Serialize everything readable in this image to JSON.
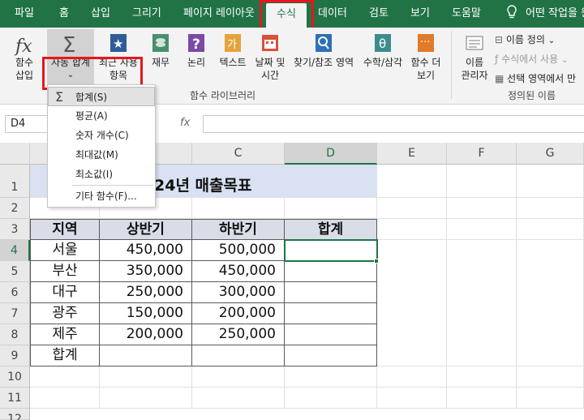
{
  "menu": {
    "tabs": [
      {
        "label": "파일"
      },
      {
        "label": "홈"
      },
      {
        "label": "삽입"
      },
      {
        "label": "그리기"
      },
      {
        "label": "페이지 레이아웃"
      },
      {
        "label": "수식"
      },
      {
        "label": "데이터"
      },
      {
        "label": "검토"
      },
      {
        "label": "보기"
      },
      {
        "label": "도움말"
      }
    ],
    "search_label": "어떤 작업을 원"
  },
  "ribbon": {
    "insert_function": "함수\n삽입",
    "autosum": "자동 합계",
    "recent": "최근 사용\n항목",
    "finance": "재무",
    "logical": "논리",
    "text": "텍스트",
    "datetime": "날짜 및\n시간",
    "lookup": "찾기/참조 영역",
    "math": "수학/삼각",
    "more": "함수 더\n보기",
    "library_label": "함수 라이브러리",
    "name_manager": "이름\n관리자",
    "define_name": "이름 정의",
    "use_in_formula": "수식에서 사용",
    "create_from_selection": "선택 영역에서 만",
    "defined_names_label": "정의된 이름"
  },
  "formula_bar": {
    "name_box": "D4",
    "fx": "fx"
  },
  "autosum_menu": {
    "items": [
      {
        "label": "합계(S)"
      },
      {
        "label": "평균(A)"
      },
      {
        "label": "숫자 개수(C)"
      },
      {
        "label": "최대값(M)"
      },
      {
        "label": "최소값(I)"
      },
      {
        "label": "기타 함수(F)..."
      }
    ]
  },
  "sheet": {
    "columns": [
      "C",
      "D",
      "E",
      "F",
      "G"
    ],
    "rows": [
      "1",
      "2",
      "3",
      "4",
      "5",
      "6",
      "7",
      "8",
      "9",
      "10",
      "11",
      "12"
    ],
    "title": "24년 매출목표",
    "headers": [
      "지역",
      "상반기",
      "하반기",
      "합계"
    ],
    "data": [
      {
        "region": "서울",
        "h1": "450,000",
        "h2": "500,000"
      },
      {
        "region": "부산",
        "h1": "350,000",
        "h2": "450,000"
      },
      {
        "region": "대구",
        "h1": "250,000",
        "h2": "300,000"
      },
      {
        "region": "광주",
        "h1": "150,000",
        "h2": "200,000"
      },
      {
        "region": "제주",
        "h1": "200,000",
        "h2": "250,000"
      }
    ],
    "total_label": "합계"
  },
  "colors": {
    "brand": "#217346",
    "highlight": "#e8151c",
    "header_fill": "#d8dde8",
    "title_fill": "#d9e1f2"
  }
}
